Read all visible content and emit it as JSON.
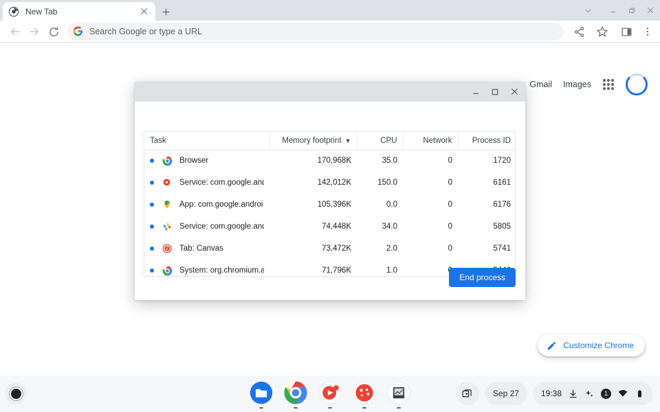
{
  "browser": {
    "tab": {
      "title": "New Tab",
      "favicon": "chrome-icon",
      "close_icon": "close-icon"
    },
    "new_tab_button": "+",
    "window_controls": {
      "chevron": "chevron-down-icon",
      "minimize": "minimize-icon",
      "maximize": "restore-icon",
      "close": "close-icon"
    },
    "toolbar": {
      "back_icon": "back-arrow-icon",
      "forward_icon": "forward-arrow-icon",
      "reload_icon": "reload-icon",
      "share_icon": "share-icon",
      "bookmark_icon": "star-icon",
      "side_panel_icon": "side-panel-icon",
      "menu_icon": "three-dot-menu-icon"
    },
    "omnibox": {
      "placeholder": "Search Google or type a URL",
      "value": "",
      "leading_icon": "google-g-icon"
    }
  },
  "new_tab_page": {
    "links": [
      {
        "label": "Gmail",
        "name": "gmail-link"
      },
      {
        "label": "Images",
        "name": "images-link"
      }
    ],
    "apps_grid_icon": "apps-grid-icon",
    "avatar_icon": "avatar-loading-ring",
    "customize": {
      "label": "Customize Chrome",
      "icon": "pencil-icon"
    }
  },
  "task_manager": {
    "window_controls": {
      "minimize": "minimize-icon",
      "maximize": "maximize-icon",
      "close": "close-icon"
    },
    "columns": [
      {
        "key": "task",
        "label": "Task",
        "align": "left",
        "sorted": false
      },
      {
        "key": "memory",
        "label": "Memory footprint",
        "align": "right",
        "sorted": true,
        "sort_arrow": "▼"
      },
      {
        "key": "cpu",
        "label": "CPU",
        "align": "right",
        "sorted": false
      },
      {
        "key": "network",
        "label": "Network",
        "align": "right",
        "sorted": false
      },
      {
        "key": "pid",
        "label": "Process ID",
        "align": "right",
        "sorted": false
      }
    ],
    "rows": [
      {
        "task": "Browser",
        "icon": "chrome-icon",
        "memory": "170,968K",
        "cpu": "35.0",
        "network": "0",
        "pid": "1720"
      },
      {
        "task": "Service: com.google.and",
        "icon": "google-red-dot-icon",
        "memory": "142,012K",
        "cpu": "150.0",
        "network": "0",
        "pid": "6161"
      },
      {
        "task": "App: com.google.androi",
        "icon": "maps-pin-icon",
        "memory": "105,396K",
        "cpu": "0.0",
        "network": "0",
        "pid": "6176"
      },
      {
        "task": "Service: com.google.and",
        "icon": "photos-icon",
        "memory": "74,448K",
        "cpu": "34.0",
        "network": "0",
        "pid": "5805"
      },
      {
        "task": "Tab: Canvas",
        "icon": "canvas-icon",
        "memory": "73,472K",
        "cpu": "2.0",
        "network": "0",
        "pid": "5741"
      },
      {
        "task": "System: org.chromium.a",
        "icon": "chrome-icon",
        "memory": "71,796K",
        "cpu": "1.0",
        "network": "0",
        "pid": "5446"
      }
    ],
    "end_process_label": "End process",
    "accent_color": "#1a73e8"
  },
  "shelf": {
    "launcher_icon": "launcher-icon",
    "apps": [
      {
        "name": "files-app",
        "icon": "files-icon"
      },
      {
        "name": "chrome-app",
        "icon": "chrome-icon"
      },
      {
        "name": "youtube-music-app",
        "icon": "play-circle-icon"
      },
      {
        "name": "recorder-app",
        "icon": "red-circle-app-icon"
      },
      {
        "name": "terminal-app",
        "icon": "terminal-icon"
      }
    ],
    "tray": {
      "screen_capture_icon": "screen-capture-icon",
      "date": "Sep 27",
      "time": "19:38",
      "download_icon": "download-icon",
      "sparkle_icon": "sparkle-icon",
      "notification_count": "1",
      "wifi_icon": "wifi-icon",
      "battery_icon": "battery-icon"
    }
  }
}
